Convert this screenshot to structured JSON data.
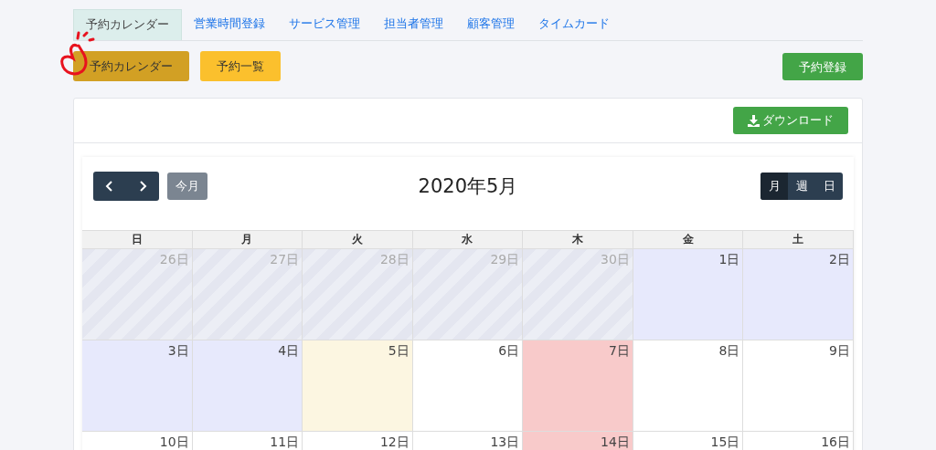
{
  "tabs": [
    {
      "label": "予約カレンダー",
      "selected": true
    },
    {
      "label": "営業時間登録",
      "selected": false
    },
    {
      "label": "サービス管理",
      "selected": false
    },
    {
      "label": "担当者管理",
      "selected": false
    },
    {
      "label": "顧客管理",
      "selected": false
    },
    {
      "label": "タイムカード",
      "selected": false
    }
  ],
  "sub_buttons": [
    {
      "label": "予約カレンダー",
      "selected": true
    },
    {
      "label": "予約一覧",
      "selected": false
    }
  ],
  "register_button": "予約登録",
  "download_button": "ダウンロード",
  "calendar": {
    "today_button": "今月",
    "title": "2020年5月",
    "views": [
      {
        "label": "月",
        "selected": true
      },
      {
        "label": "週",
        "selected": false
      },
      {
        "label": "日",
        "selected": false
      }
    ],
    "weekdays": [
      "日",
      "月",
      "火",
      "水",
      "木",
      "金",
      "土"
    ],
    "weeks": [
      [
        {
          "day": "26日",
          "kind": "past"
        },
        {
          "day": "27日",
          "kind": "past"
        },
        {
          "day": "28日",
          "kind": "past"
        },
        {
          "day": "29日",
          "kind": "past"
        },
        {
          "day": "30日",
          "kind": "past"
        },
        {
          "day": "1日",
          "kind": "holiday"
        },
        {
          "day": "2日",
          "kind": "holiday"
        }
      ],
      [
        {
          "day": "3日",
          "kind": "holiday"
        },
        {
          "day": "4日",
          "kind": "holiday"
        },
        {
          "day": "5日",
          "kind": "today"
        },
        {
          "day": "6日",
          "kind": "normal"
        },
        {
          "day": "7日",
          "kind": "closed"
        },
        {
          "day": "8日",
          "kind": "normal"
        },
        {
          "day": "9日",
          "kind": "normal"
        }
      ],
      [
        {
          "day": "10日",
          "kind": "normal"
        },
        {
          "day": "11日",
          "kind": "normal"
        },
        {
          "day": "12日",
          "kind": "normal"
        },
        {
          "day": "13日",
          "kind": "normal"
        },
        {
          "day": "14日",
          "kind": "closed"
        },
        {
          "day": "15日",
          "kind": "normal"
        },
        {
          "day": "16日",
          "kind": "normal"
        }
      ]
    ]
  }
}
